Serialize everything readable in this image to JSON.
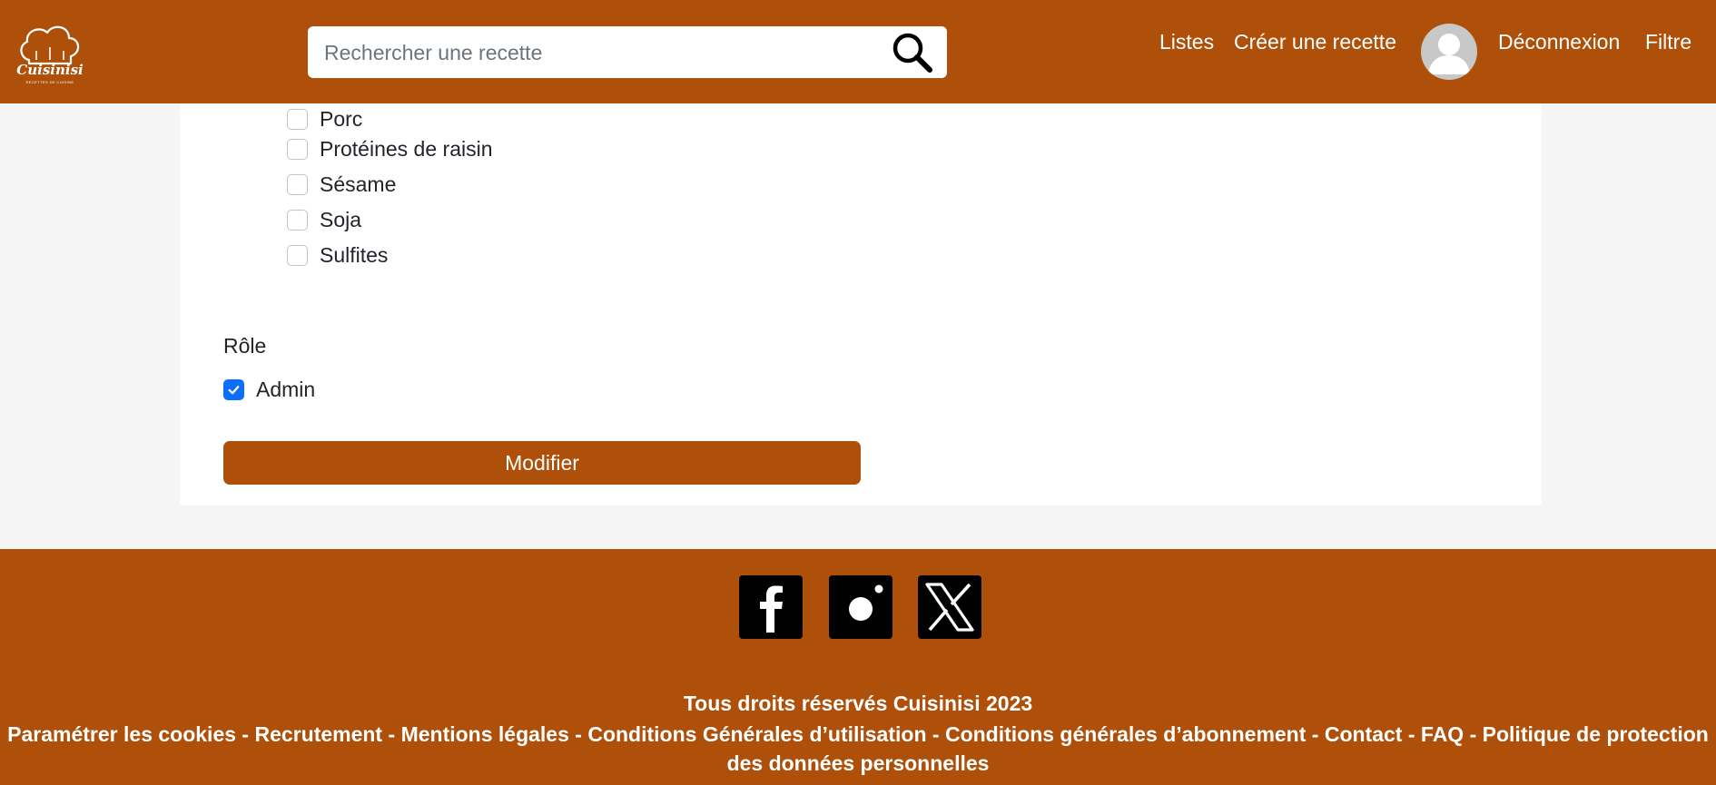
{
  "app": {
    "logo_text": "Cuisinisi",
    "logo_tagline": "RECETTES DE CUISINE"
  },
  "header": {
    "search_placeholder": "Rechercher une recette",
    "nav": {
      "lists": "Listes",
      "create_recipe": "Créer une recette",
      "logout": "Déconnexion",
      "filter": "Filtre"
    }
  },
  "allergens": [
    {
      "label": "Porc",
      "checked": false
    },
    {
      "label": "Protéines de raisin",
      "checked": false
    },
    {
      "label": "Sésame",
      "checked": false
    },
    {
      "label": "Soja",
      "checked": false
    },
    {
      "label": "Sulfites",
      "checked": false
    }
  ],
  "role": {
    "label": "Rôle",
    "options": [
      {
        "label": "Admin",
        "checked": true
      }
    ]
  },
  "form": {
    "submit_label": "Modifier"
  },
  "footer": {
    "social": [
      "facebook-icon",
      "instagram-icon",
      "x-icon"
    ],
    "copyright": "Tous droits réservés Cuisinisi 2023",
    "links": [
      "Paramétrer les cookies",
      "Recrutement",
      "Mentions légales",
      "Conditions Générales d’utilisation",
      "Conditions générales d’abonnement",
      "Contact",
      "FAQ",
      "Politique de protection des données personnelles"
    ],
    "separator": " - "
  },
  "colors": {
    "brand": "#ae500a",
    "checkbox_checked": "#0d6efd",
    "page_background": "#f5f5f5"
  }
}
